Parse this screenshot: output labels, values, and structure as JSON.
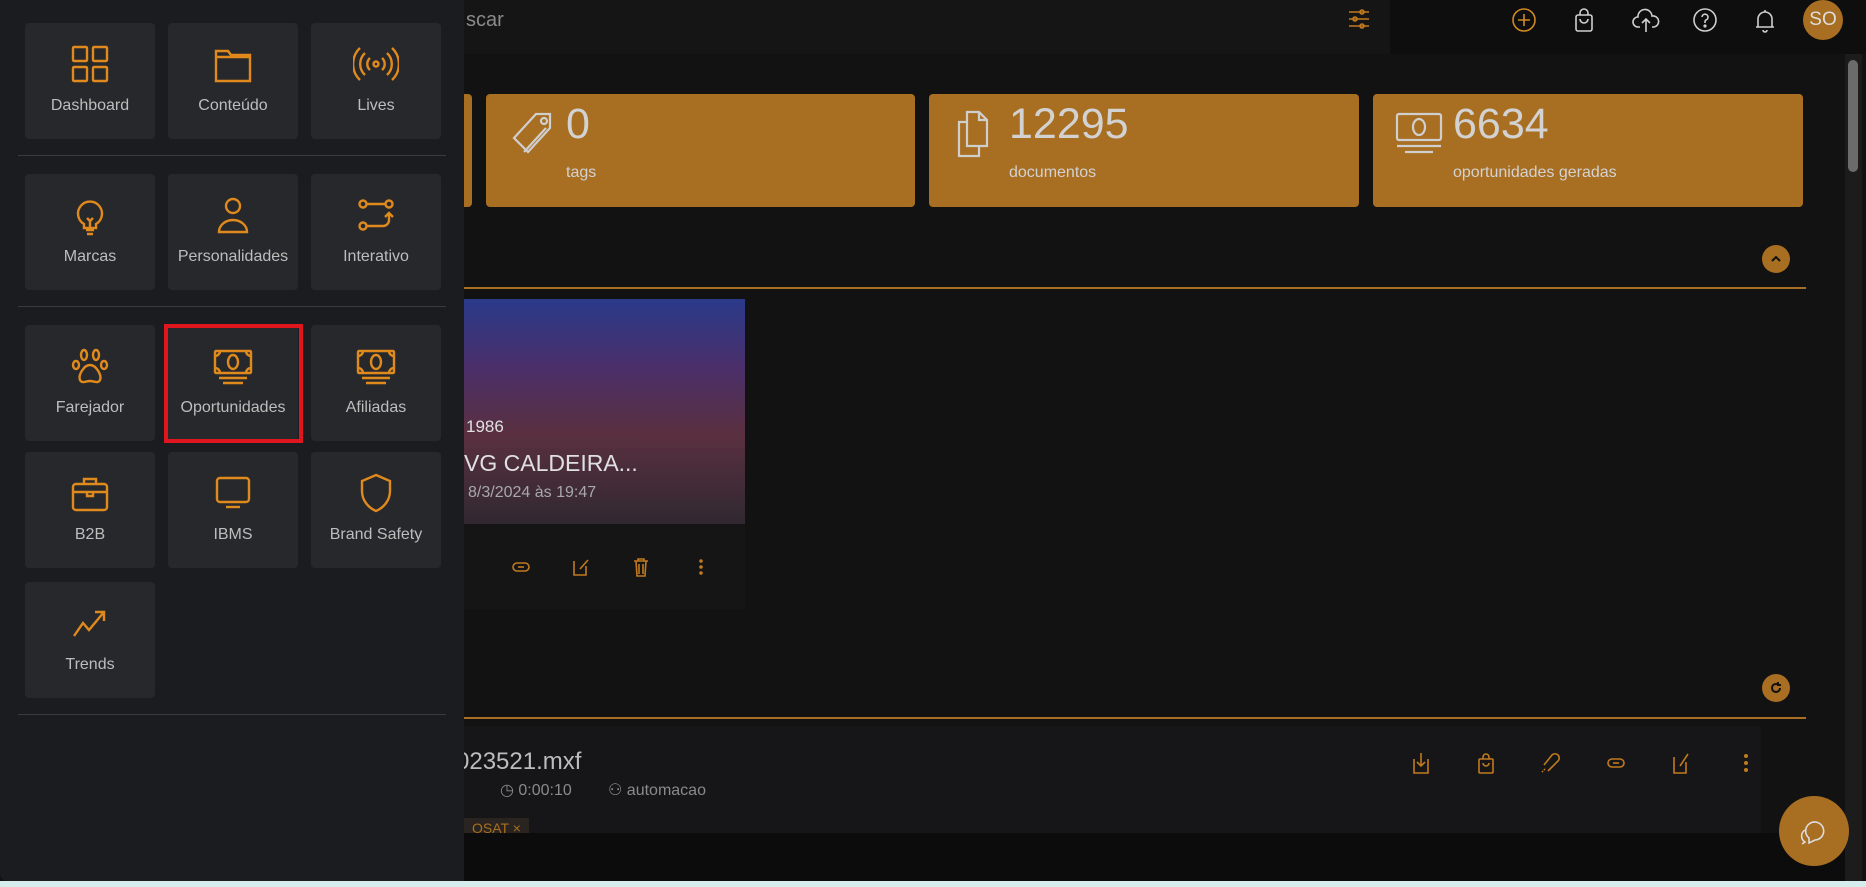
{
  "topbar": {
    "search_placeholder_visible": "scar",
    "icons": [
      "filter-sliders-icon",
      "add-circle-icon",
      "shopping-bag-icon",
      "cloud-upload-icon",
      "help-icon",
      "bell-icon"
    ],
    "avatar_initials": "SO"
  },
  "stats": [
    {
      "value": "0",
      "label": "tags",
      "icon": "tag-icon"
    },
    {
      "value": "12295",
      "label": "documentos",
      "icon": "documents-icon"
    },
    {
      "value": "6634",
      "label": "oportunidades geradas",
      "icon": "money-icon"
    }
  ],
  "video_card": {
    "year": "1986",
    "title": "VG CALDEIRA...",
    "date": "8/3/2024 às 19:47"
  },
  "list_item": {
    "filename": "023521.mxf",
    "duration": "0:00:10",
    "user": "automacao",
    "tag": "OSAT",
    "tag_remove": "×"
  },
  "menu": {
    "items": [
      {
        "label": "Dashboard",
        "icon": "grid-icon"
      },
      {
        "label": "Conteúdo",
        "icon": "folder-icon"
      },
      {
        "label": "Lives",
        "icon": "broadcast-icon"
      },
      {
        "label": "Marcas",
        "icon": "lightbulb-icon"
      },
      {
        "label": "Personalidades",
        "icon": "person-icon"
      },
      {
        "label": "Interativo",
        "icon": "flow-icon"
      },
      {
        "label": "Farejador",
        "icon": "paw-icon"
      },
      {
        "label": "Oportunidades",
        "icon": "money-icon",
        "highlighted": true
      },
      {
        "label": "Afiliadas",
        "icon": "money-icon"
      },
      {
        "label": "B2B",
        "icon": "briefcase-icon"
      },
      {
        "label": "IBMS",
        "icon": "monitor-icon"
      },
      {
        "label": "Brand Safety",
        "icon": "shield-icon"
      },
      {
        "label": "Trends",
        "icon": "trending-up-icon"
      }
    ]
  },
  "colors": {
    "accent": "#a86e21",
    "icon_orange": "#e08a1e",
    "highlight": "#e0161f",
    "background": "#121212"
  }
}
